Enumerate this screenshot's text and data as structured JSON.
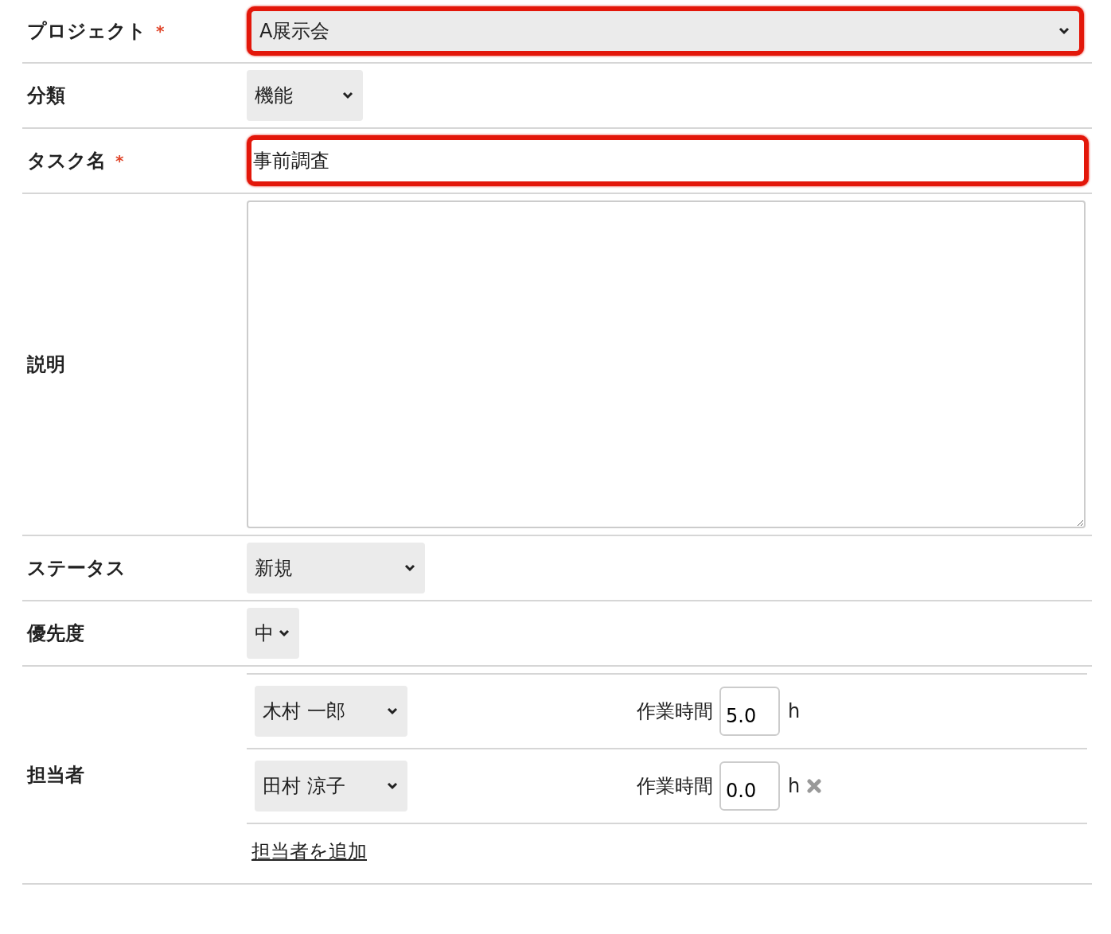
{
  "required_mark": "*",
  "fields": [
    {
      "kind": "wide-select",
      "label": "プロジェクト",
      "required": true,
      "value": "A展示会",
      "error": true
    },
    {
      "kind": "select",
      "label": "分類",
      "required": false,
      "value": "機能",
      "error": false
    },
    {
      "kind": "text",
      "label": "タスク名",
      "required": true,
      "value": "事前調査",
      "error": true
    },
    {
      "kind": "textarea",
      "label": "説明",
      "required": false,
      "error": false
    },
    {
      "kind": "select",
      "label": "ステータス",
      "required": false,
      "value": "新規",
      "error": false
    },
    {
      "kind": "select",
      "label": "優先度",
      "required": false,
      "value": "中",
      "error": false
    },
    {
      "kind": "assignees",
      "label": "担当者",
      "required": false,
      "error": false,
      "assignees": [
        {
          "name": "木村 一郎",
          "hours_label": "作業時間",
          "hours": "5.0",
          "unit": "h",
          "removable": false
        },
        {
          "name": "田村 涼子",
          "hours_label": "作業時間",
          "hours": "0.0",
          "unit": "h",
          "removable": true
        }
      ],
      "add_link": "担当者を追加"
    }
  ]
}
